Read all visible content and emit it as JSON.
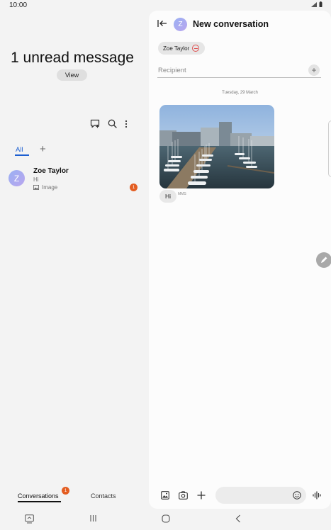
{
  "status_bar": {
    "time": "10:00"
  },
  "left_pane": {
    "unread_title": "1 unread message",
    "view_button": "View",
    "tabs": [
      {
        "label": "All"
      }
    ],
    "conversations": [
      {
        "avatar_letter": "Z",
        "name": "Zoe Taylor",
        "preview": "Hi",
        "attachment": "Image",
        "unread_count": "1"
      }
    ],
    "bottom_tabs": {
      "conversations": "Conversations",
      "conversations_badge": "1",
      "contacts": "Contacts"
    }
  },
  "right_pane": {
    "header": {
      "avatar_letter": "Z",
      "title": "New conversation"
    },
    "recipient_chip": "Zoe Taylor",
    "recipient_placeholder": "Recipient",
    "date_separator": "Tuesday, 29 March",
    "message": {
      "text": "Hi",
      "type": "MMS"
    }
  },
  "colors": {
    "accent": "#1d5fd1",
    "badge": "#e35d21",
    "avatar": "#a9b2f1"
  },
  "icons": [
    "new-chat-icon",
    "search-icon",
    "more-options-icon",
    "back-icon",
    "gallery-icon",
    "camera-icon",
    "add-icon",
    "emoji-icon",
    "voice-icon",
    "edit-icon"
  ]
}
